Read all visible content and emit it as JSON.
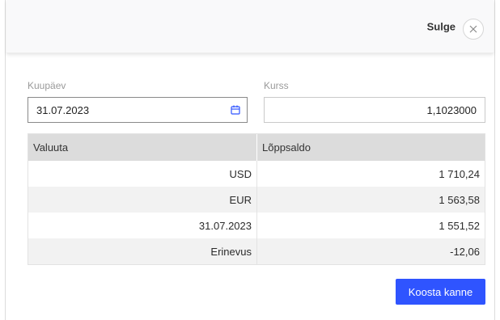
{
  "header": {
    "close_label": "Sulge"
  },
  "form": {
    "date_label": "Kuupäev",
    "date_value": "31.07.2023",
    "rate_label": "Kurss",
    "rate_value": "1,1023000"
  },
  "table": {
    "columns": [
      "Valuuta",
      "Lõppsaldo"
    ],
    "rows": [
      {
        "label": "USD",
        "value": "1 710,24"
      },
      {
        "label": "EUR",
        "value": "1 563,58"
      },
      {
        "label": "31.07.2023",
        "value": "1 551,52"
      },
      {
        "label": "Erinevus",
        "value": "-12,06"
      }
    ]
  },
  "actions": {
    "primary_label": "Koosta kanne"
  },
  "colors": {
    "primary": "#2f54ff",
    "header_bg": "#f9f9fa",
    "table_head_bg": "#dcdcdc",
    "table_alt_bg": "#f2f2f2"
  },
  "icons": {
    "close": "close-icon",
    "calendar": "calendar-icon"
  }
}
